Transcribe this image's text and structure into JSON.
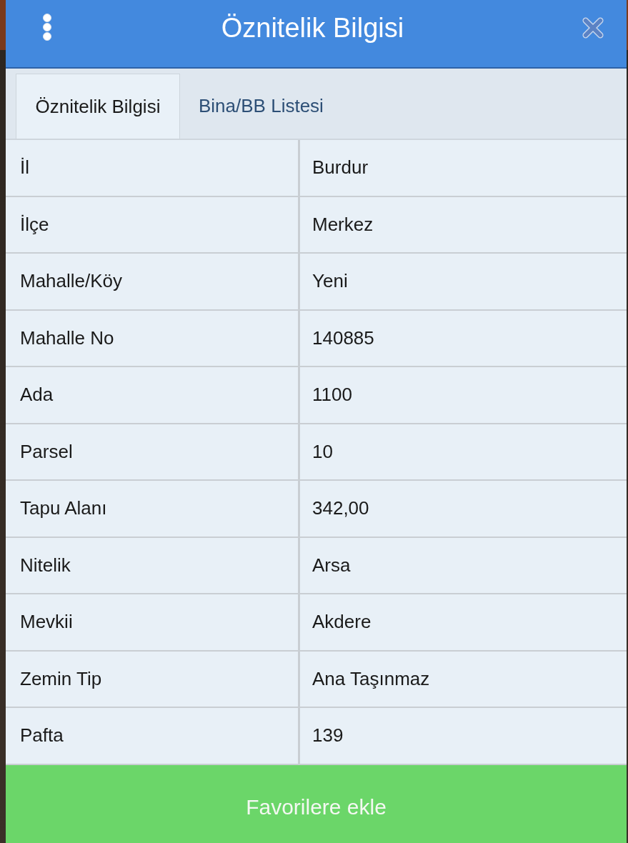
{
  "header": {
    "title": "Öznitelik Bilgisi"
  },
  "tabs": [
    {
      "label": "Öznitelik Bilgisi",
      "selected": true
    },
    {
      "label": "Bina/BB Listesi",
      "selected": false
    }
  ],
  "table": {
    "rows": [
      {
        "label": "İl",
        "value": "Burdur"
      },
      {
        "label": "İlçe",
        "value": "Merkez"
      },
      {
        "label": "Mahalle/Köy",
        "value": "Yeni"
      },
      {
        "label": "Mahalle No",
        "value": "140885"
      },
      {
        "label": "Ada",
        "value": "1100"
      },
      {
        "label": "Parsel",
        "value": "10"
      },
      {
        "label": "Tapu Alanı",
        "value": "342,00"
      },
      {
        "label": "Nitelik",
        "value": "Arsa"
      },
      {
        "label": "Mevkii",
        "value": "Akdere"
      },
      {
        "label": "Zemin Tip",
        "value": "Ana Taşınmaz"
      },
      {
        "label": "Pafta",
        "value": "139"
      }
    ]
  },
  "footer_button": {
    "label": "Favorilere ekle"
  }
}
